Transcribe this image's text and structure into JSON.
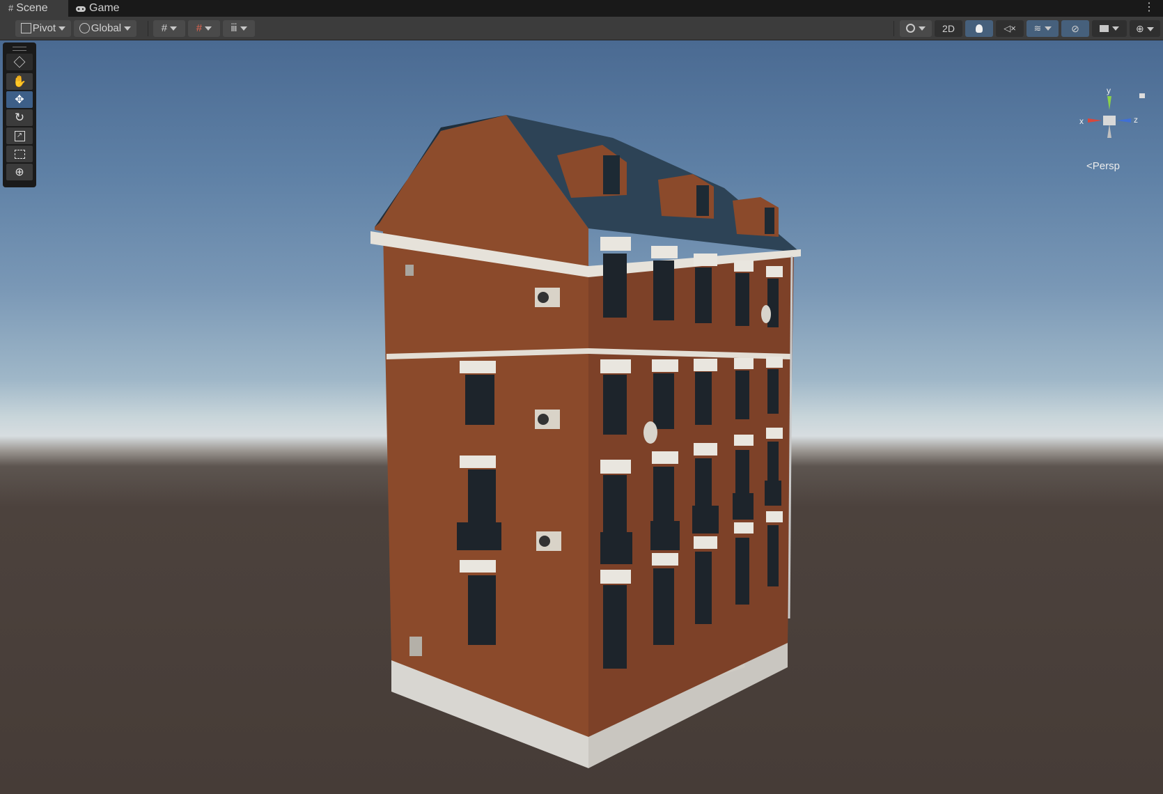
{
  "tabs": [
    {
      "label": "Scene",
      "icon": "grid-hash-icon"
    },
    {
      "label": "Game",
      "icon": "gamepad-icon"
    }
  ],
  "toolbar": {
    "pivot_label": "Pivot",
    "global_label": "Global",
    "two_d_label": "2D"
  },
  "tools": [
    {
      "name": "view-tool",
      "icon": "hand-icon"
    },
    {
      "name": "move-tool",
      "icon": "move-arrows-icon",
      "active": true
    },
    {
      "name": "rotate-tool",
      "icon": "rotate-icon"
    },
    {
      "name": "scale-tool",
      "icon": "scale-icon"
    },
    {
      "name": "rect-tool",
      "icon": "rect-transform-icon"
    },
    {
      "name": "transform-tool",
      "icon": "transform-icon"
    }
  ],
  "gizmo": {
    "axis_y": "y",
    "axis_x": "x",
    "axis_z": "z",
    "projection": "Persp",
    "colors": {
      "x": "#d9473b",
      "y": "#8bd04a",
      "z": "#3f6fd6"
    }
  },
  "colors": {
    "accent": "#46607c",
    "brick": "#8c4a2a",
    "roof": "#263847"
  }
}
